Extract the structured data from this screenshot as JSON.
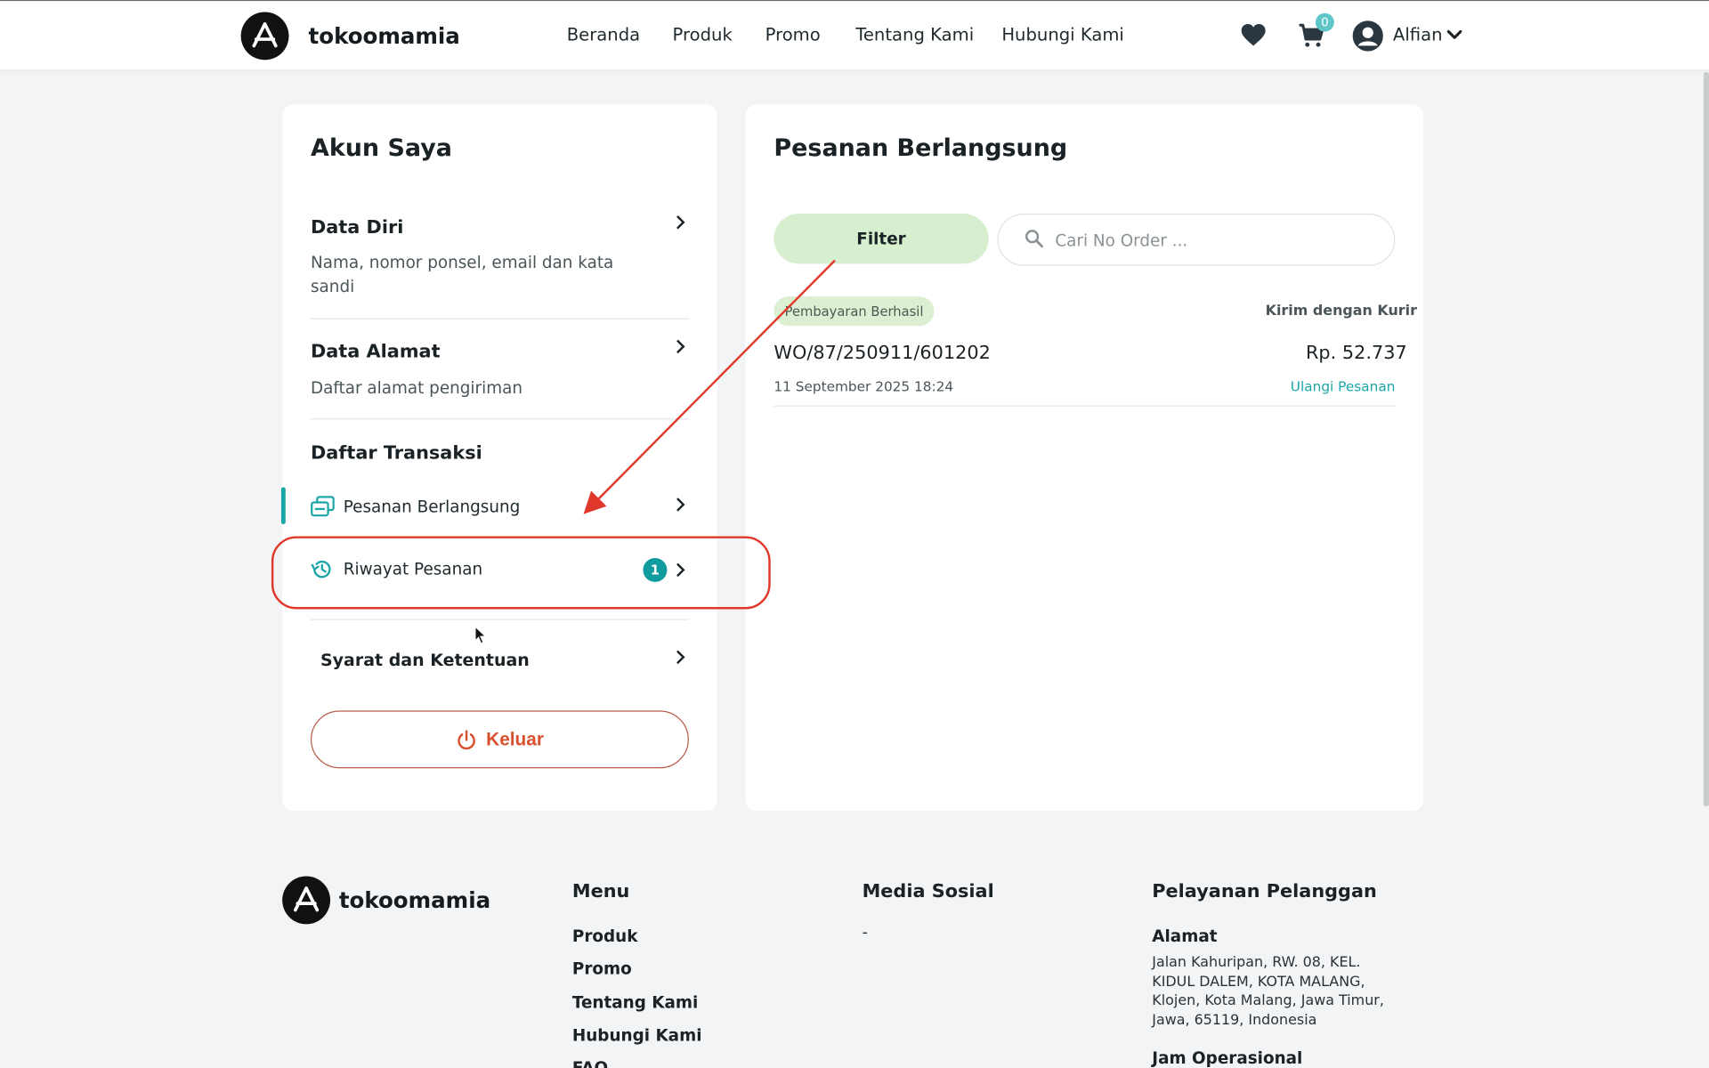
{
  "navbar": {
    "brand": "tokoomamia",
    "links": [
      "Beranda",
      "Produk",
      "Promo",
      "Tentang Kami",
      "Hubungi Kami"
    ],
    "cart_count": "0",
    "user_name": "Alfian"
  },
  "sidebar": {
    "title": "Akun Saya",
    "data_diri": {
      "title": "Data Diri",
      "desc": "Nama, nomor ponsel, email dan kata sandi"
    },
    "data_alamat": {
      "title": "Data Alamat",
      "desc": "Daftar alamat pengiriman"
    },
    "transactions_title": "Daftar Transaksi",
    "ongoing_label": "Pesanan Berlangsung",
    "history_label": "Riwayat Pesanan",
    "history_count": "1",
    "terms_label": "Syarat dan Ketentuan",
    "logout_label": "Keluar"
  },
  "main": {
    "title": "Pesanan Berlangsung",
    "filter_label": "Filter",
    "search_placeholder": "Cari No Order ...",
    "order": {
      "status": "Pembayaran Berhasil",
      "shipping": "Kirim dengan Kurir",
      "number": "WO/87/250911/601202",
      "total": "Rp. 52.737",
      "date": "11 September 2025 18:24",
      "reorder_label": "Ulangi Pesanan"
    }
  },
  "footer": {
    "brand": "tokoomamia",
    "menu_title": "Menu",
    "menu_links": [
      "Produk",
      "Promo",
      "Tentang Kami",
      "Hubungi Kami",
      "FAQ"
    ],
    "social_title": "Media Sosial",
    "social_value": "-",
    "service_title": "Pelayanan Pelanggan",
    "address_label": "Alamat",
    "address_text": "Jalan Kahuripan, RW. 08, KEL. KIDUL DALEM, KOTA MALANG, Klojen, Kota Malang, Jawa Timur, Jawa, 65119, Indonesia",
    "hours_label": "Jam Operasional"
  },
  "colors": {
    "accent": "#1aa5a7",
    "badge": "#109c9f",
    "annotation_red": "#e0392b",
    "logout": "#d9502f",
    "status_bg": "#dcefd3",
    "filter_bg": "#d8efcf"
  },
  "icons": [
    "logo-icon",
    "heart-icon",
    "cart-icon",
    "user-avatar-icon",
    "chevron-down-icon",
    "chevron-right-icon",
    "orders-icon",
    "history-icon",
    "power-icon",
    "search-icon",
    "mouse-cursor-icon"
  ]
}
